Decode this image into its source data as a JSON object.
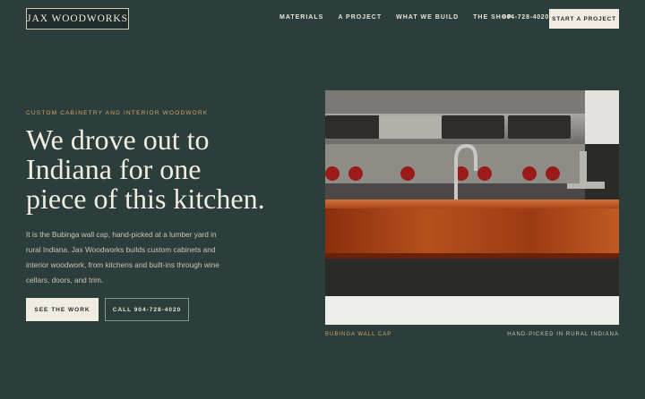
{
  "header": {
    "logo": "JAX WOODWORKS",
    "nav": [
      "MATERIALS",
      "A PROJECT",
      "WHAT WE BUILD",
      "THE SHOP"
    ],
    "phone": "904-728-4020",
    "cta": "START A PROJECT"
  },
  "hero": {
    "eyebrow": "CUSTOM CABINETRY AND INTERIOR WOODWORK",
    "headline_lines": [
      "We drove out to",
      "Indiana for one",
      "piece of this kitchen."
    ],
    "body": "It is the Bubinga wall cap, hand-picked at a lumber yard in rural Indiana. Jax Woodworks builds custom cabinets and interior woodwork, from kitchens and built-ins through wine cellars, doors, and trim.",
    "primary_button": "SEE THE WORK",
    "secondary_button": "CALL 904-728-4020"
  },
  "photo": {
    "caption_left": "BUBINGA WALL CAP",
    "caption_right": "HAND-PICKED IN RURAL INDIANA"
  },
  "colors": {
    "background": "#2c3e3b",
    "accent": "#d3a46a",
    "cream": "#f1ece1"
  }
}
